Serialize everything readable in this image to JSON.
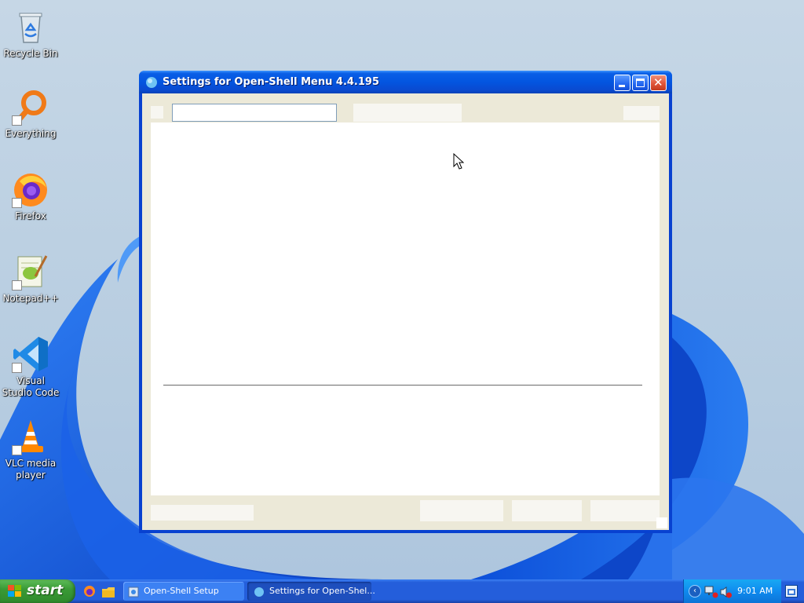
{
  "desktop_icons": [
    {
      "label": "Recycle Bin",
      "icon": "recycle-bin-icon"
    },
    {
      "label": "Everything",
      "icon": "everything-search-icon"
    },
    {
      "label": "Firefox",
      "icon": "firefox-icon"
    },
    {
      "label": "Notepad++",
      "icon": "notepad-plus-plus-icon"
    },
    {
      "label": "Visual Studio Code",
      "icon": "vscode-icon"
    },
    {
      "label": "VLC media player",
      "icon": "vlc-icon"
    }
  ],
  "window": {
    "title": "Settings for Open-Shell Menu 4.4.195",
    "search_value": "",
    "title_color": "#0a5fe6"
  },
  "taskbar": {
    "start_label": "start",
    "tasks": [
      {
        "label": "Open-Shell Setup"
      },
      {
        "label": "Settings for Open-Shel..."
      }
    ],
    "clock": "9:01 AM"
  },
  "colors": {
    "taskbar_blue": "#245edb",
    "start_green": "#3a9a36",
    "tray_blue": "#0f8bef"
  }
}
